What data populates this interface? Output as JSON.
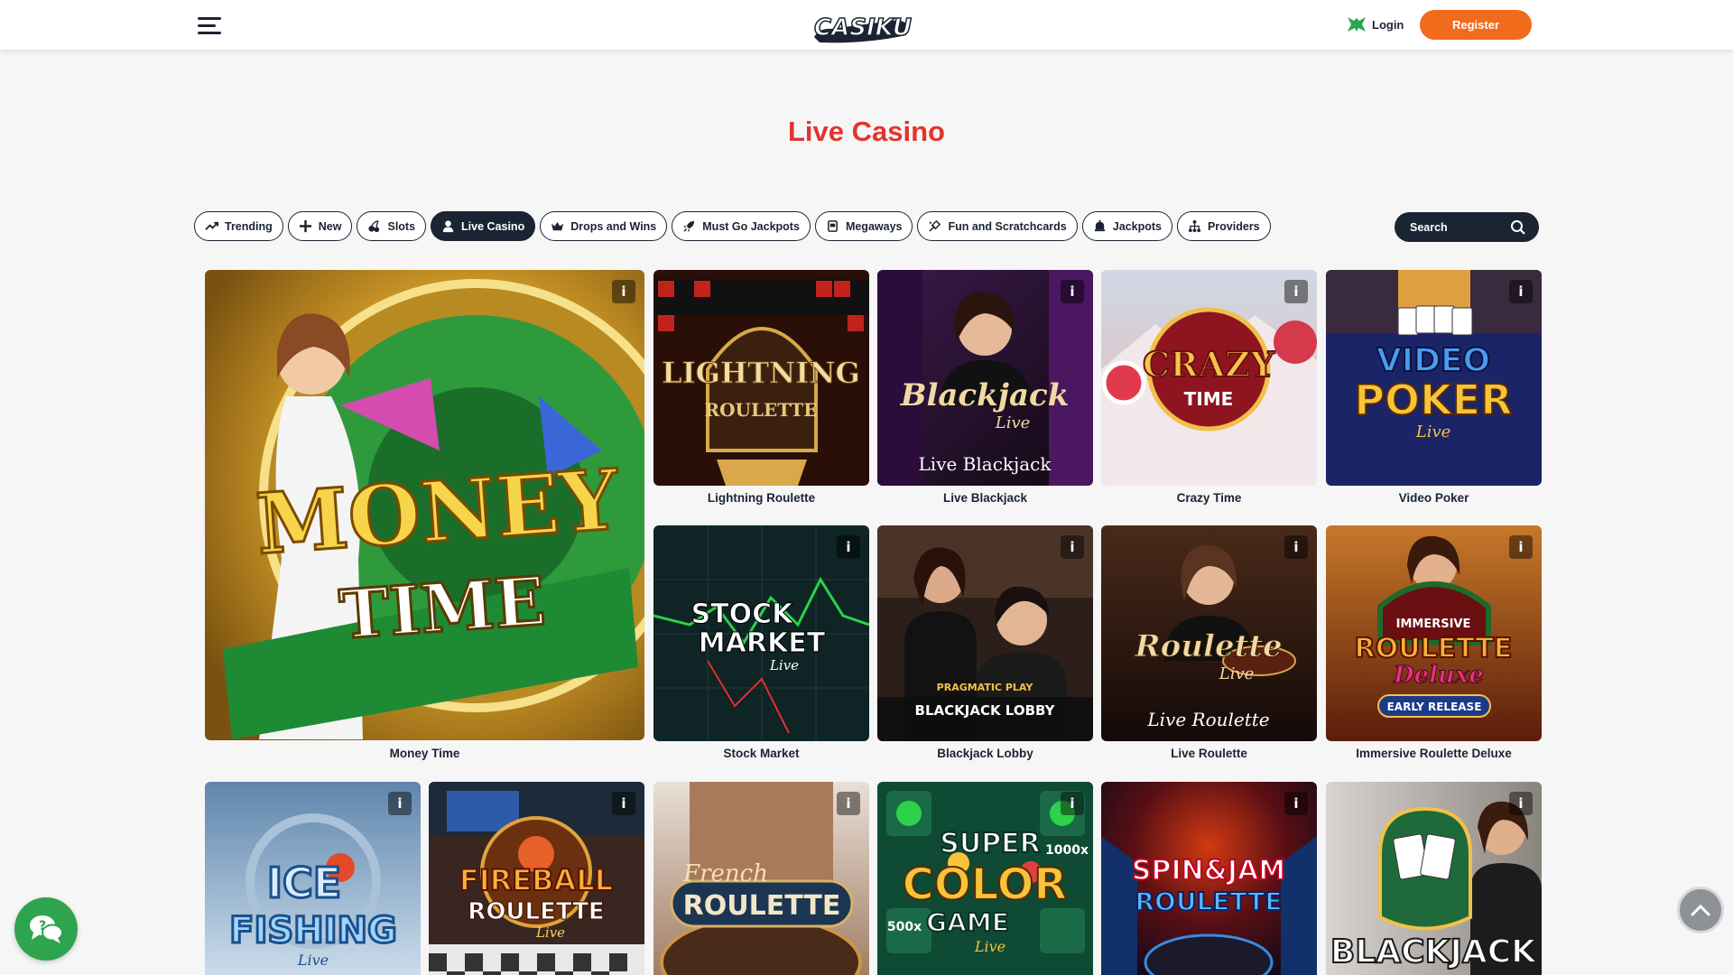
{
  "header": {
    "logo_text": "CASIKU",
    "menu_icon": "hamburger-menu-icon",
    "login_label": "Login",
    "login_icon": "green-frog-icon",
    "register_label": "Register",
    "accent_color": "#f26a1b"
  },
  "page": {
    "title": "Live Casino",
    "title_color": "#e0352c"
  },
  "categories": [
    {
      "label": "Trending",
      "icon": "trending-icon",
      "active": false
    },
    {
      "label": "New",
      "icon": "plus-icon",
      "active": false
    },
    {
      "label": "Slots",
      "icon": "cherries-icon",
      "active": false
    },
    {
      "label": "Live Casino",
      "icon": "dealer-icon",
      "active": true
    },
    {
      "label": "Drops and Wins",
      "icon": "crown-icon",
      "active": false
    },
    {
      "label": "Must Go Jackpots",
      "icon": "rocket-icon",
      "active": false
    },
    {
      "label": "Megaways",
      "icon": "slot-machine-icon",
      "active": false
    },
    {
      "label": "Fun and Scratchcards",
      "icon": "scratch-icon",
      "active": false
    },
    {
      "label": "Jackpots",
      "icon": "bell-icon",
      "active": false
    },
    {
      "label": "Providers",
      "icon": "network-icon",
      "active": false
    }
  ],
  "search": {
    "placeholder": "Search",
    "icon": "magnifier-icon"
  },
  "games": [
    {
      "name": "Money Time",
      "art_text": [
        "MONEY",
        "TIME"
      ]
    },
    {
      "name": "Lightning Roulette",
      "art_text": [
        "LIGHTNING",
        "ROULETTE"
      ]
    },
    {
      "name": "Live Blackjack",
      "art_text": [
        "Blackjack",
        "Live",
        "Live Blackjack"
      ]
    },
    {
      "name": "Crazy Time",
      "art_text": [
        "CRAZY",
        "TIME"
      ]
    },
    {
      "name": "Video Poker",
      "art_text": [
        "VIDEO",
        "POKER",
        "Live"
      ]
    },
    {
      "name": "Stock Market",
      "art_text": [
        "STOCK",
        "MARKET",
        "Live"
      ]
    },
    {
      "name": "Blackjack Lobby",
      "art_text": [
        "PRAGMATIC PLAY",
        "BLACKJACK LOBBY"
      ]
    },
    {
      "name": "Live Roulette",
      "art_text": [
        "Roulette",
        "Live",
        "Live Roulette"
      ]
    },
    {
      "name": "Immersive Roulette Deluxe",
      "art_text": [
        "IMMERSIVE",
        "ROULETTE",
        "Deluxe",
        "EARLY RELEASE"
      ]
    },
    {
      "name": "Ice Fishing",
      "art_text": [
        "ICE",
        "FISHING",
        "Live"
      ]
    },
    {
      "name": "Fireball Roulette",
      "art_text": [
        "FIREBALL",
        "ROULETTE",
        "Live"
      ]
    },
    {
      "name": "French Roulette",
      "art_text": [
        "French",
        "ROULETTE"
      ]
    },
    {
      "name": "Super Color Game",
      "art_text": [
        "SUPER",
        "COLOR",
        "GAME",
        "1000x",
        "500x",
        "Live"
      ]
    },
    {
      "name": "Spin & Jam Roulette",
      "art_text": [
        "SPIN&JAM",
        "ROULETTE"
      ]
    },
    {
      "name": "Blackjack",
      "art_text": [
        "BLACKJACK"
      ]
    }
  ],
  "info_button_label": "i",
  "floating": {
    "chat_icon": "chat-bubble-icon",
    "scroll_top_icon": "chevron-up-icon"
  }
}
